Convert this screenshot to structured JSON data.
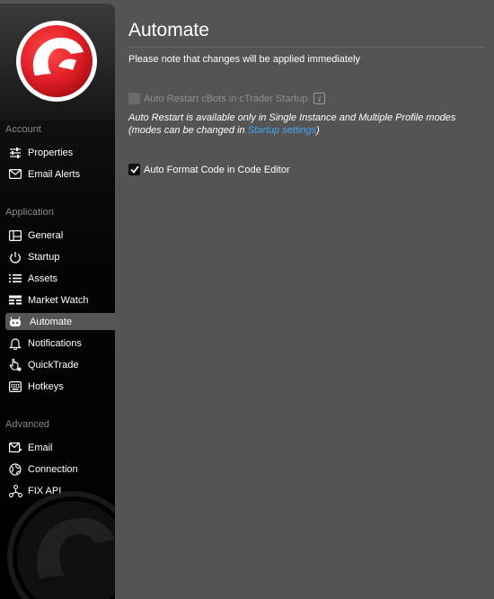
{
  "sidebar": {
    "sections": {
      "account": "Account",
      "application": "Application",
      "advanced": "Advanced"
    },
    "items": [
      {
        "label": "Properties",
        "icon": "sliders-icon"
      },
      {
        "label": "Email Alerts",
        "icon": "envelope-icon"
      },
      {
        "label": "General",
        "icon": "layout-icon"
      },
      {
        "label": "Startup",
        "icon": "power-icon"
      },
      {
        "label": "Assets",
        "icon": "list-icon"
      },
      {
        "label": "Market Watch",
        "icon": "market-watch-icon"
      },
      {
        "label": "Automate",
        "icon": "robot-icon",
        "active": true
      },
      {
        "label": "Notifications",
        "icon": "bell-icon"
      },
      {
        "label": "QuickTrade",
        "icon": "hand-pointer-icon"
      },
      {
        "label": "Hotkeys",
        "icon": "keyboard-icon"
      },
      {
        "label": "Email",
        "icon": "email-send-icon"
      },
      {
        "label": "Connection",
        "icon": "globe-icon"
      },
      {
        "label": "FIX API",
        "icon": "network-icon"
      }
    ]
  },
  "main": {
    "title": "Automate",
    "note": "Please note that changes will be applied immediately",
    "options": {
      "auto_restart": {
        "label": "Auto Restart cBots in cTrader Startup",
        "checked": false,
        "disabled": true,
        "info_glyph": "i"
      },
      "auto_format": {
        "label": "Auto Format Code in Code Editor",
        "checked": true,
        "disabled": false
      }
    },
    "help": {
      "line1": "Auto Restart is available only in Single Instance and Multiple Profile modes",
      "line2_prefix": "(modes can be changed in ",
      "link": "Startup settings",
      "line2_suffix": ")"
    }
  },
  "colors": {
    "background": "#545454",
    "sidebar": "#000000",
    "active_item": "#555555",
    "link": "#4aa3f0",
    "brand_red": "#e01f26"
  }
}
